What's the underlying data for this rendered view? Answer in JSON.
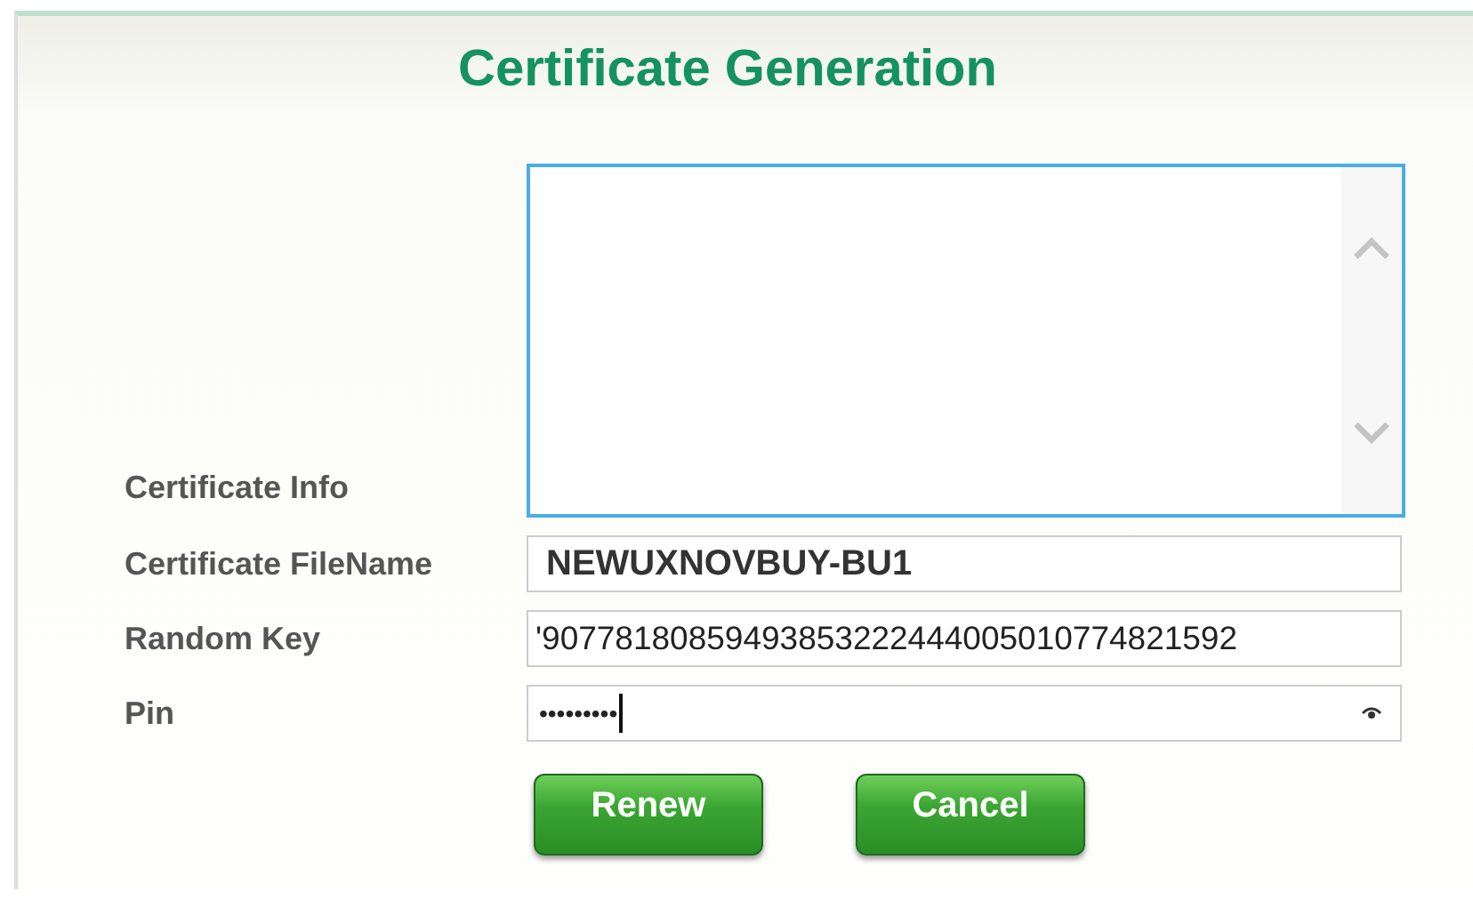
{
  "title": "Certificate Generation",
  "fields": [
    {
      "kind": "textarea",
      "label": "Certificate Info",
      "focused": true
    },
    {
      "kind": "text",
      "label": "Certificate FileName",
      "value": "NEWUXNOVBUY-BU1"
    },
    {
      "kind": "text",
      "label": "Random Key",
      "value": "'90778180859493853222444005010774821592"
    },
    {
      "kind": "password",
      "label": "Pin",
      "value": "•••••••••"
    }
  ],
  "buttons": [
    "Renew",
    "Cancel"
  ]
}
